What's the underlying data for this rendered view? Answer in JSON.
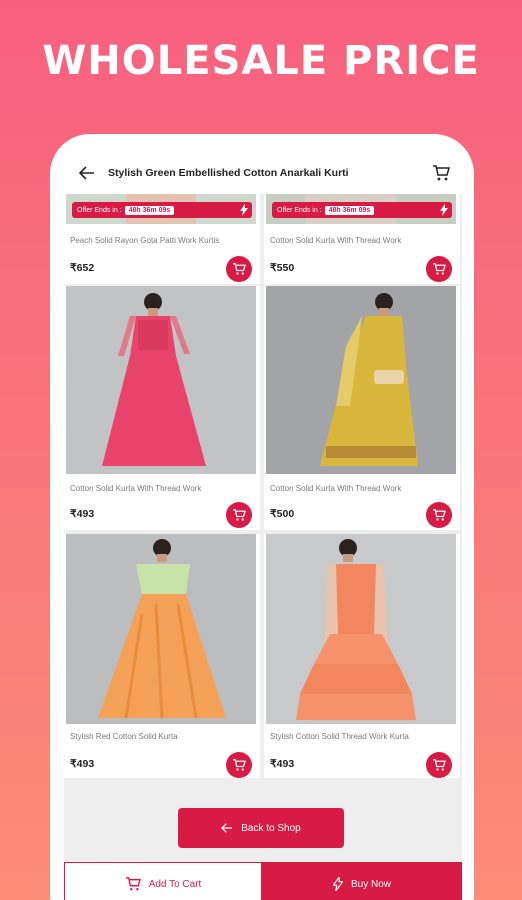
{
  "banner": {
    "headline": "WHOLESALE PRICE"
  },
  "appbar": {
    "title": "Stylish Green Embellished Cotton Anarkali Kurti"
  },
  "products": [
    {
      "name": "Peach Solid Rayon Gota Patti Work Kurtis",
      "price": "₹652",
      "offer_label": "Offer Ends in :",
      "timer": "48h 36m 09s"
    },
    {
      "name": "Cotton Solid Kurta With Thread Work",
      "price": "₹550",
      "offer_label": "Offer Ends in :",
      "timer": "48h 36m 09s"
    },
    {
      "name": "Cotton Solid Kurta With Thread Work",
      "price": "₹493"
    },
    {
      "name": "Cotton Solid Kurta With Thread Work",
      "price": "₹500"
    },
    {
      "name": "Stylish Red Cotton Solid Kurta",
      "price": "₹493"
    },
    {
      "name": "Stylish Cotton Solid Thread Work Kurta",
      "price": "₹493"
    }
  ],
  "actions": {
    "back_to_shop": "Back to Shop",
    "add_to_cart": "Add To Cart",
    "buy_now": "Buy Now"
  },
  "colors": {
    "accent": "#d81b44",
    "background_top": "#f8607f",
    "background_bottom": "#fb8d78"
  },
  "icons": [
    "back-arrow-icon",
    "cart-icon",
    "flash-icon"
  ]
}
